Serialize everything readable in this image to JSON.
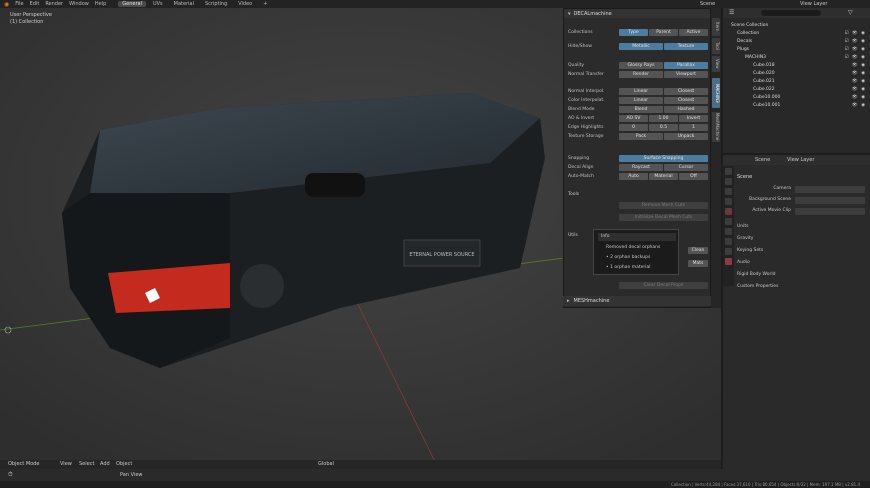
{
  "topbar": {
    "menus": [
      "File",
      "Edit",
      "Render",
      "Window",
      "Help"
    ],
    "workspaces": [
      "General",
      "UVs",
      "Material",
      "Scripting",
      "Video"
    ],
    "active_workspace": "General",
    "scene_label": "Scene",
    "view_layer_label": "View Layer"
  },
  "viewport": {
    "view_name": "User Perspective",
    "collection": "(1) Collection",
    "mode": "Object Mode",
    "menus": [
      "View",
      "Select",
      "Add",
      "Object"
    ],
    "orientation": "Global"
  },
  "npanel": {
    "title": "DECALmachine",
    "rows": [
      {
        "label": "Collections",
        "buttons": [
          "Type",
          "Parent",
          "Active"
        ]
      },
      {
        "label": "Hide/Show",
        "buttons": [
          "Metallic",
          "Texture"
        ]
      },
      {
        "label": "Quality",
        "buttons": [
          "Glossy Rays",
          "Parallax"
        ]
      },
      {
        "label": "Normal Transfer",
        "buttons": [
          "Render",
          "Viewport"
        ]
      },
      {
        "label": "Normal Interpol.",
        "buttons": [
          "Linear",
          "Closest"
        ]
      },
      {
        "label": "Color Interpolat.",
        "buttons": [
          "Linear",
          "Closest"
        ]
      },
      {
        "label": "Blend Mode",
        "buttons": [
          "Blend",
          "Hashed"
        ]
      },
      {
        "label": "AO & Invert",
        "buttons": [
          "AO SV",
          "1.00",
          "Invert"
        ]
      },
      {
        "label": "Edge Highlights",
        "buttons": [
          "0",
          "0.5",
          "1"
        ]
      },
      {
        "label": "Texture Storage",
        "buttons": [
          "Pack",
          "Unpack"
        ]
      },
      {
        "label": "Snapping",
        "buttons": [
          "Surface Snapping"
        ]
      },
      {
        "label": "Decal Align",
        "buttons": [
          "Raycast",
          "Cursor"
        ]
      },
      {
        "label": "Auto-Match",
        "buttons": [
          "Auto",
          "Material",
          "Off"
        ]
      }
    ],
    "tools_label": "Tools",
    "tools_buttons": [
      "Remove Mesh Cuts",
      "Initialize Decal Mesh Cuts"
    ],
    "utils_label": "Utils",
    "utils_buttons": [
      "Clean",
      "Mats",
      "Clear Decal Props"
    ],
    "footer": "MESHmachine",
    "tabs": [
      "Item",
      "Tool",
      "View",
      "MACHIN3",
      "MeshMachine"
    ]
  },
  "popup": {
    "title": "Info",
    "lines": [
      "Removed decal orphans",
      "• 2 orphan backups",
      "• 1 orphan material"
    ]
  },
  "outliner": {
    "search_placeholder": "",
    "rows": [
      {
        "name": "Scene Collection",
        "depth": 0
      },
      {
        "name": "Collection",
        "depth": 1
      },
      {
        "name": "Decals",
        "depth": 1
      },
      {
        "name": "Plugs",
        "depth": 1
      },
      {
        "name": "MACHIN3",
        "depth": 2
      },
      {
        "name": "Cube.018",
        "depth": 3
      },
      {
        "name": "Cube.020",
        "depth": 3
      },
      {
        "name": "Cube.021",
        "depth": 3
      },
      {
        "name": "Cube.022",
        "depth": 3
      },
      {
        "name": "Cube10.000",
        "depth": 3
      },
      {
        "name": "Cube10.001",
        "depth": 3
      }
    ]
  },
  "properties": {
    "header_scene": "Scene",
    "header_view_layer": "View Layer",
    "section_scene": "Scene",
    "fields": [
      {
        "label": "Camera",
        "value": ""
      },
      {
        "label": "Background Scene",
        "value": ""
      },
      {
        "label": "Active Movie Clip",
        "value": ""
      }
    ],
    "sections": [
      "Units",
      "Gravity",
      "Keying Sets",
      "Audio",
      "Rigid Body World",
      "Custom Properties"
    ]
  },
  "timeline": {
    "pan_view": "Pan View"
  },
  "statusbar": {
    "stats": "Collection | Verts:44,284 | Faces:37,616 | Tris:80,654 | Objects:0/32 | Mem: 197.1 MB | v2.81.4"
  },
  "colors": {
    "accent_blue": "#4c7ca0",
    "red_panel": "#c42a1d",
    "box_body": "#1c1f22"
  }
}
